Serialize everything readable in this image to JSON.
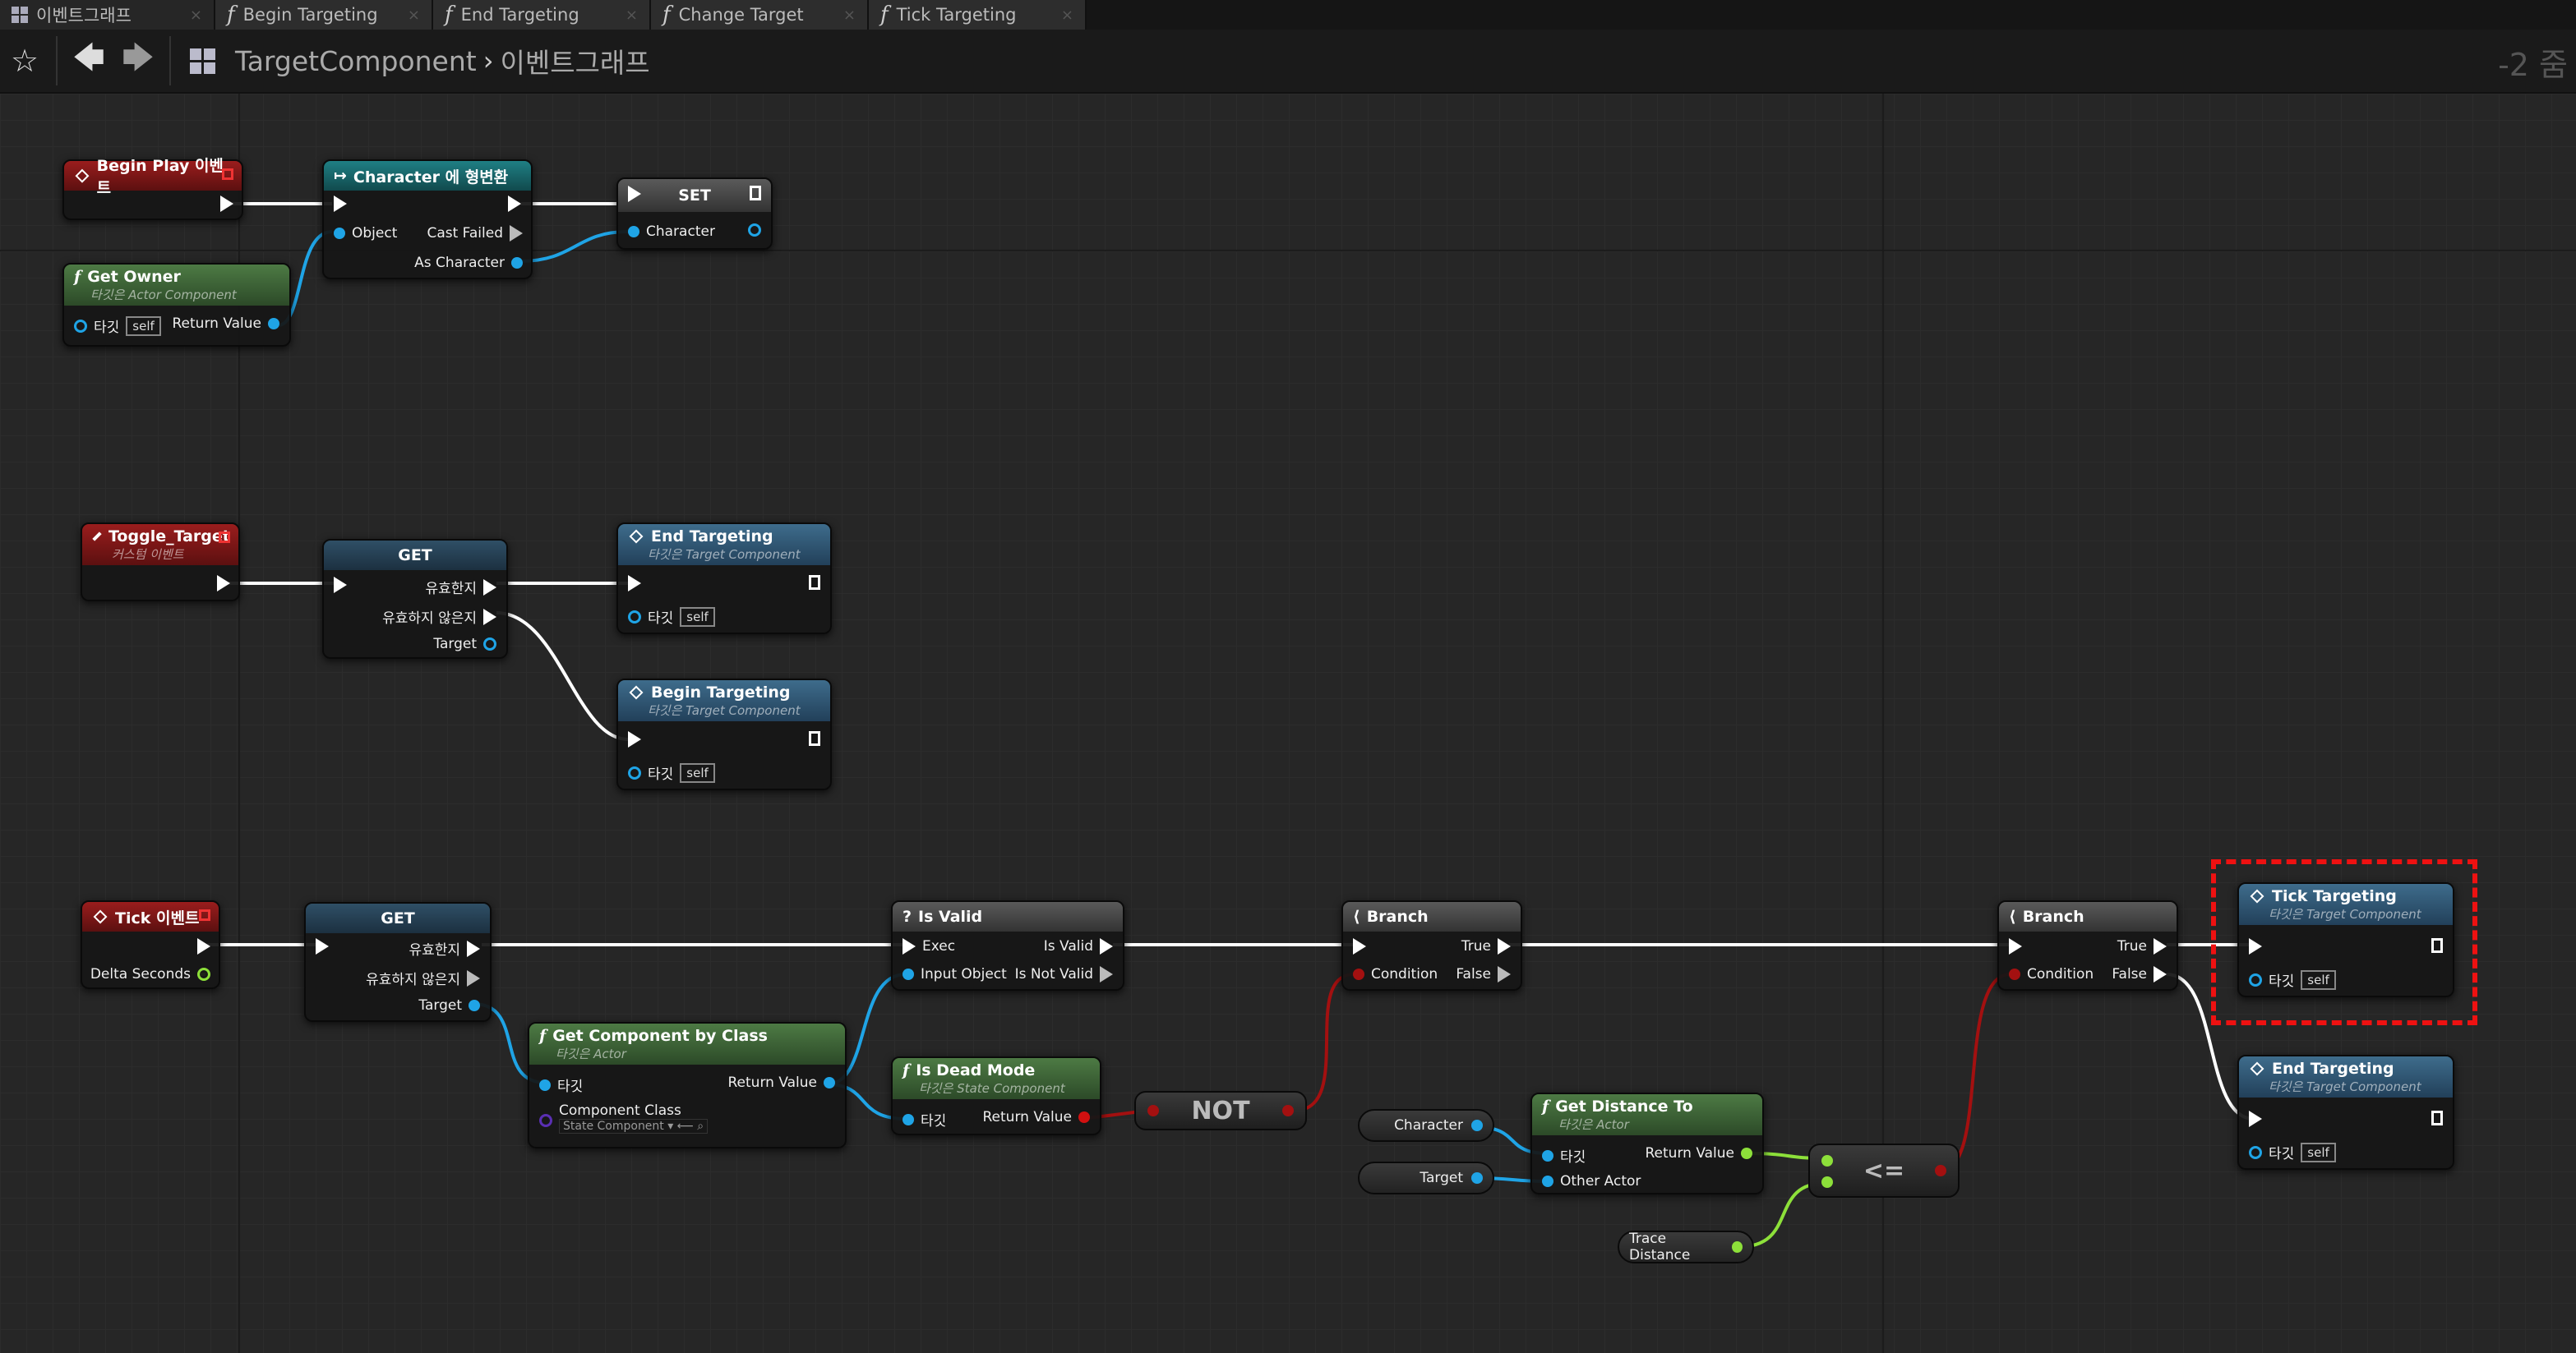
{
  "tabs": [
    {
      "label": "이벤트그래프",
      "icon": "event-graph-icon"
    },
    {
      "label": "Begin Targeting",
      "icon": "function-icon"
    },
    {
      "label": "End Targeting",
      "icon": "function-icon"
    },
    {
      "label": "Change Target",
      "icon": "function-icon"
    },
    {
      "label": "Tick Targeting",
      "icon": "function-icon"
    }
  ],
  "toolbar": {
    "breadcrumb_root": "TargetComponent",
    "breadcrumb_sep": "›",
    "breadcrumb_current": "이벤트그래프",
    "zoom": "-2 줌"
  },
  "nodes": {
    "beginplay": {
      "title": "Begin Play 이벤트"
    },
    "castchar": {
      "title": "Character 에 형변환",
      "object": "Object",
      "castfailed": "Cast Failed",
      "aschar": "As Character"
    },
    "set": {
      "title": "SET",
      "character": "Character"
    },
    "getowner": {
      "title": "Get Owner",
      "sub": "타깃은 Actor Component",
      "target": "타깃",
      "self": "self",
      "ret": "Return Value"
    },
    "toggle": {
      "title": "Toggle_Target",
      "sub": "커스텀 이벤트"
    },
    "get1": {
      "title": "GET",
      "valid": "유효한지",
      "notvalid": "유효하지 않은지",
      "target": "Target"
    },
    "endt1": {
      "title": "End Targeting",
      "sub": "타깃은 Target Component",
      "target": "타깃",
      "self": "self"
    },
    "begint": {
      "title": "Begin Targeting",
      "sub": "타깃은 Target Component",
      "target": "타깃",
      "self": "self"
    },
    "tick": {
      "title": "Tick 이벤트",
      "delta": "Delta Seconds"
    },
    "get2": {
      "title": "GET",
      "valid": "유효한지",
      "notvalid": "유효하지 않은지",
      "target": "Target"
    },
    "getcomp": {
      "title": "Get Component by Class",
      "sub": "타깃은 Actor",
      "target": "타깃",
      "ret": "Return Value",
      "compclass": "Component Class",
      "compval": "State Component"
    },
    "isvalid": {
      "title": "Is Valid",
      "exec": "Exec",
      "input": "Input Object",
      "isvalid": "Is Valid",
      "notvalid": "Is Not Valid"
    },
    "isdead": {
      "title": "Is Dead Mode",
      "sub": "타깃은 State Component",
      "target": "타깃",
      "ret": "Return Value"
    },
    "not": {
      "title": "NOT"
    },
    "branch1": {
      "title": "Branch",
      "cond": "Condition",
      "true": "True",
      "false": "False"
    },
    "getdist": {
      "title": "Get Distance To",
      "sub": "타깃은 Actor",
      "target": "타깃",
      "other": "Other Actor",
      "ret": "Return Value"
    },
    "varchar": {
      "title": "Character"
    },
    "vartarget": {
      "title": "Target"
    },
    "vartrace": {
      "title": "Trace Distance"
    },
    "le": {
      "title": "<="
    },
    "branch2": {
      "title": "Branch",
      "cond": "Condition",
      "true": "True",
      "false": "False"
    },
    "tickt": {
      "title": "Tick Targeting",
      "sub": "타깃은 Target Component",
      "target": "타깃",
      "self": "self"
    },
    "endt2": {
      "title": "End Targeting",
      "sub": "타깃은 Target Component",
      "target": "타깃",
      "self": "self"
    }
  },
  "colors": {
    "exec": "#ffffff",
    "object": "#1fa4e6",
    "bool": "#a31010",
    "float": "#8de03a",
    "class": "#5a2fb3",
    "selection": "#e11111"
  }
}
